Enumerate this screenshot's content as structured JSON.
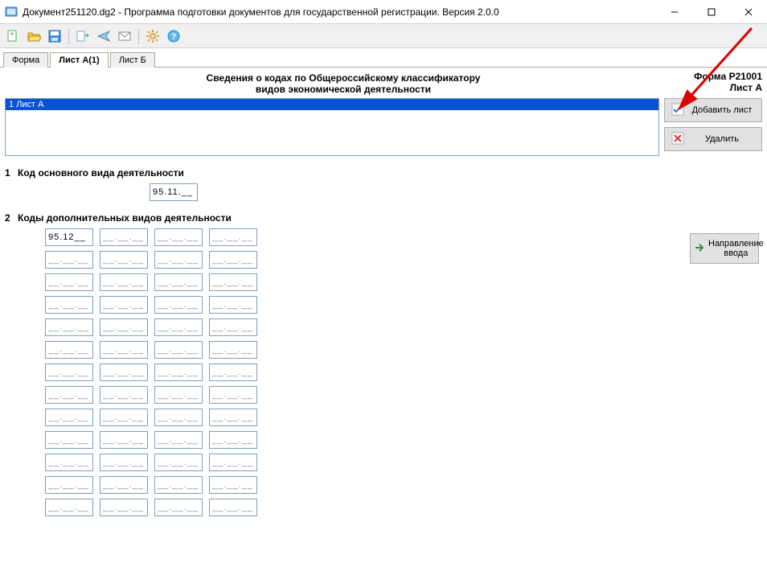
{
  "window": {
    "title": "Документ251120.dg2 - Программа подготовки документов для государственной регистрации. Версия 2.0.0"
  },
  "tabs": {
    "t0": "Форма",
    "t1": "Лист А(1)",
    "t2": "Лист Б"
  },
  "header": {
    "line1": "Сведения о кодах по Общероссийскому классификатору",
    "line2": "видов экономической деятельности",
    "form_code": "Форма Р21001",
    "sheet_name": "Лист А"
  },
  "sheet_list": {
    "item1": "1 Лист А"
  },
  "buttons": {
    "add_sheet": "Добавить лист",
    "delete": "Удалить",
    "direction": "Направление ввода"
  },
  "sections": {
    "s1_num": "1",
    "s1_label": "Код основного вида деятельности",
    "s2_num": "2",
    "s2_label": "Коды дополнительных видов деятельности"
  },
  "values": {
    "main_code": "95.11.__",
    "extra_code_0": "95.12__",
    "mask": "__.__.__"
  }
}
